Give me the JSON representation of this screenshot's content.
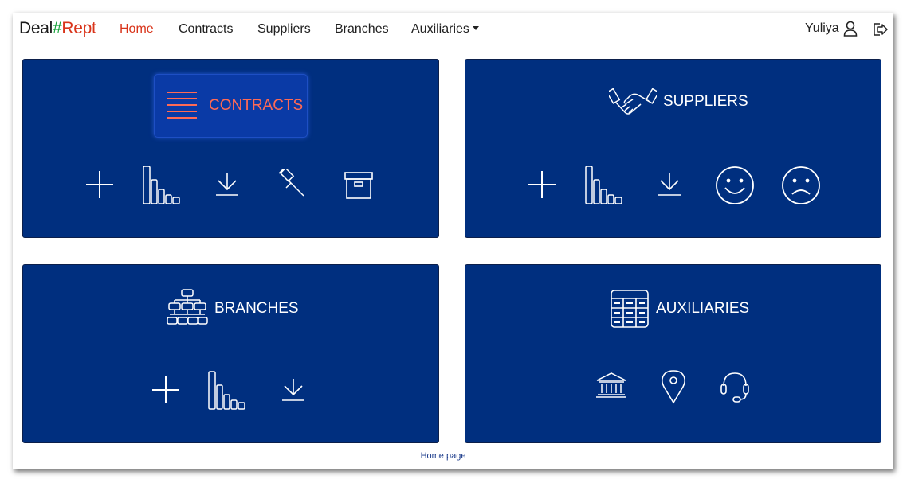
{
  "brand": {
    "part1": "Deal",
    "part2": "#",
    "part3": "Rept"
  },
  "nav": {
    "home": "Home",
    "contracts": "Contracts",
    "suppliers": "Suppliers",
    "branches": "Branches",
    "auxiliaries": "Auxiliaries"
  },
  "user": {
    "name": "Yuliya"
  },
  "cards": {
    "contracts": {
      "title": "CONTRACTS",
      "icon": "list-lines-icon",
      "tools": [
        "plus-icon",
        "bar-chart-icon",
        "download-icon",
        "gavel-icon",
        "archive-box-icon"
      ]
    },
    "suppliers": {
      "title": "SUPPLIERS",
      "icon": "handshake-icon",
      "tools": [
        "plus-icon",
        "bar-chart-icon",
        "download-icon",
        "smile-icon",
        "frown-icon"
      ]
    },
    "branches": {
      "title": "BRANCHES",
      "icon": "org-chart-icon",
      "tools": [
        "plus-icon",
        "bar-chart-icon",
        "download-icon"
      ]
    },
    "auxiliaries": {
      "title": "AUXILIARIES",
      "icon": "table-grid-icon",
      "tools": [
        "bank-icon",
        "map-pin-icon",
        "headset-icon"
      ]
    }
  },
  "footer": {
    "text": "Home page"
  },
  "colors": {
    "card_bg": "#002f7f",
    "accent_red": "#d9341a",
    "brand_green": "#18a33c",
    "contracts_highlight": "#0a3aa6",
    "contracts_text": "#ff6a55"
  }
}
